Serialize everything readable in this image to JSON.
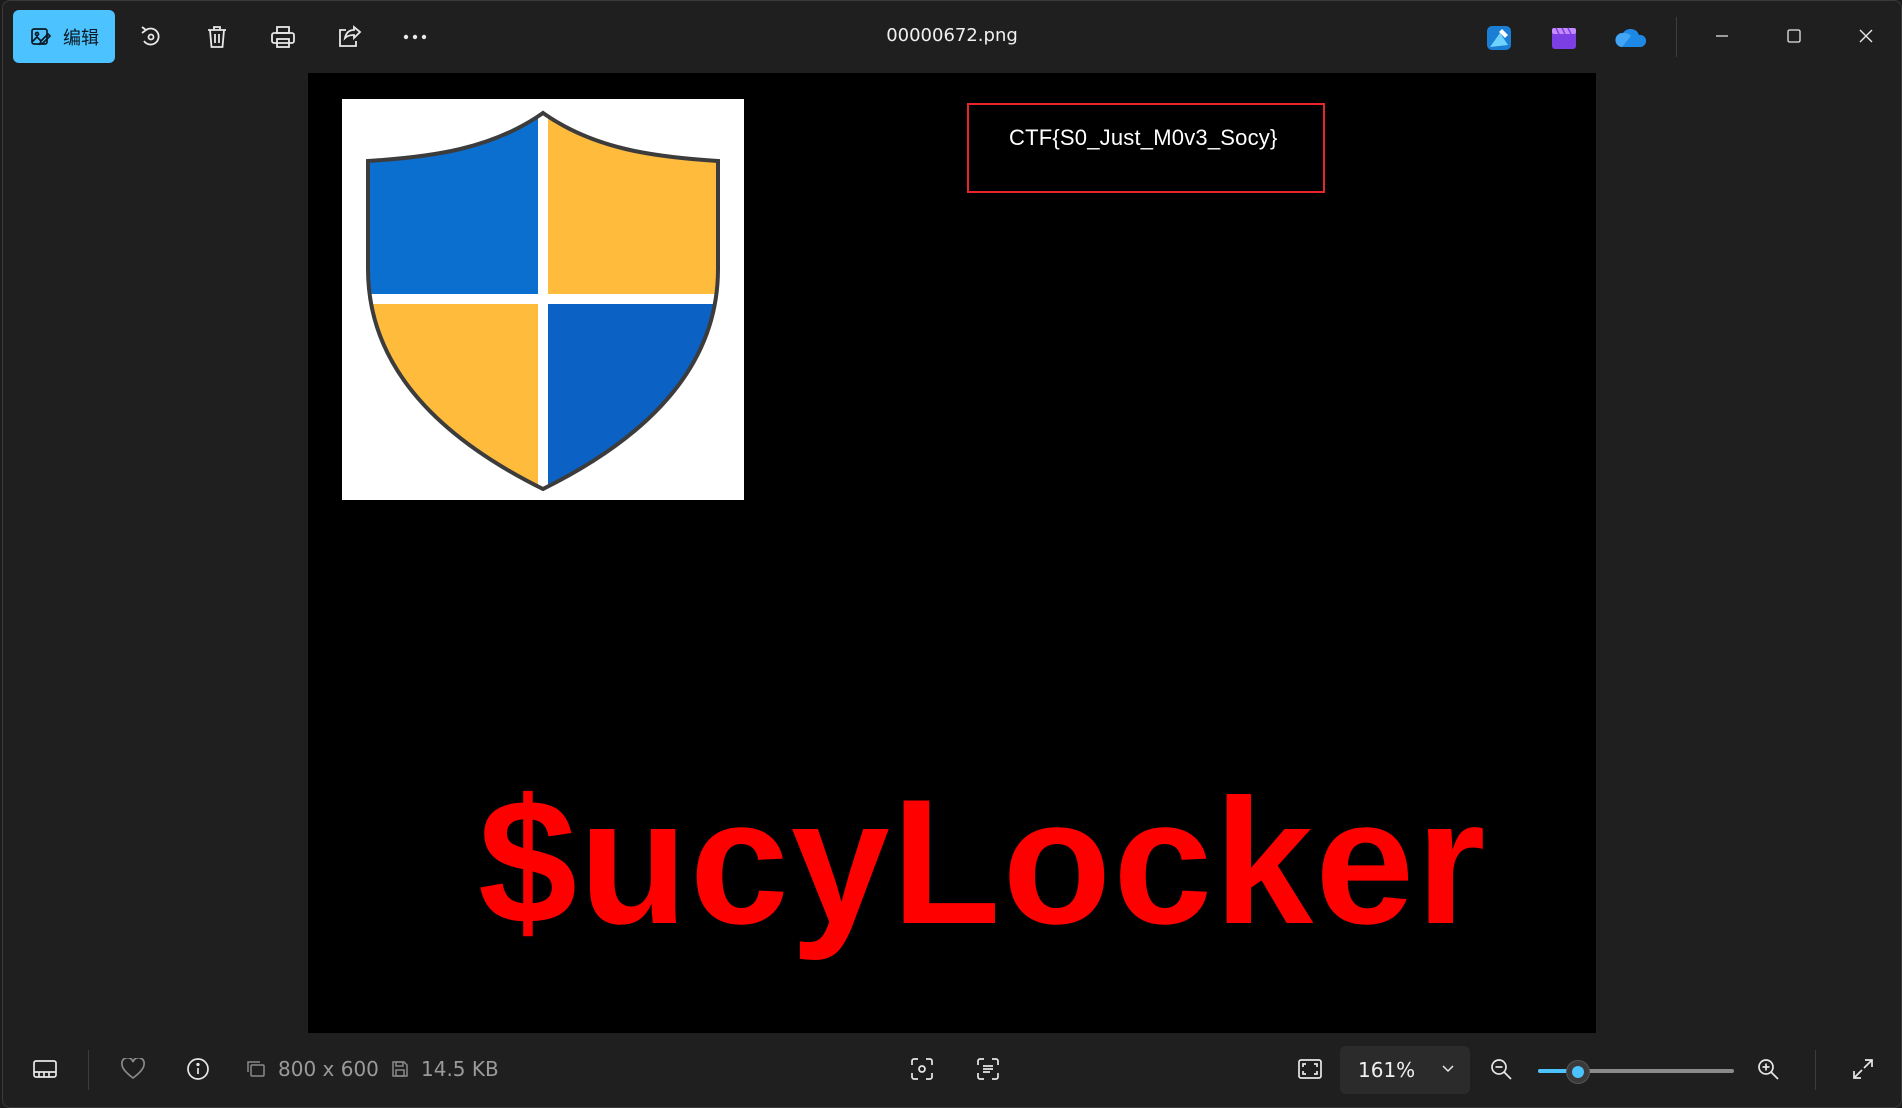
{
  "toolbar": {
    "edit_label": "编辑",
    "buttons": [
      "rotate-icon",
      "delete-icon",
      "print-icon",
      "share-icon",
      "more-icon"
    ]
  },
  "window": {
    "title": "00000672.png"
  },
  "app_icons": [
    "photos-edit-app-icon",
    "clipchamp-icon",
    "onedrive-icon"
  ],
  "image": {
    "flag_text": "CTF{S0_Just_M0v3_Socy}",
    "banner_text": "$ucyLocker"
  },
  "statusbar": {
    "dimensions": "800 x 600",
    "file_size": "14.5 KB",
    "zoom_value": "161%",
    "zoom_slider_fraction": 0.2
  },
  "colors": {
    "accent": "#4cc2ff",
    "flag_border": "#e8262a",
    "banner": "#ff0000",
    "shield_blue": "#0b6fcf",
    "shield_yellow": "#ffbb3c"
  }
}
